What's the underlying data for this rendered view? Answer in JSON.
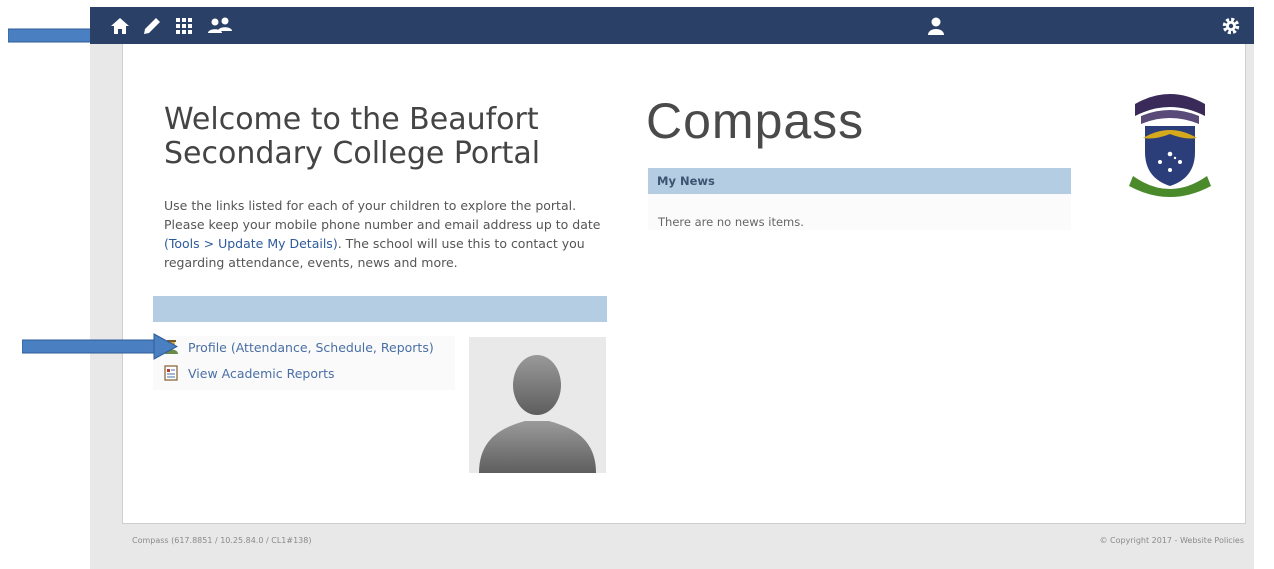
{
  "navbar": {
    "icons": [
      "home-icon",
      "pencil-icon",
      "grid-icon",
      "people-icon",
      "user-icon",
      "gear-icon"
    ]
  },
  "welcome": {
    "title": "Welcome to the Beaufort Secondary College Portal",
    "intro_1": "Use the links listed for each of your children to explore the portal. Please keep your mobile phone number and email address up to date ",
    "intro_link": "(Tools > Update My Details)",
    "intro_2": ". The school will use this to contact you regarding attendance, events, news and more."
  },
  "student": {
    "profile_link": "Profile (Attendance, Schedule, Reports)",
    "reports_link": "View Academic Reports"
  },
  "app_title": "Compass",
  "news": {
    "header": "My News",
    "empty_text": "There are no news items."
  },
  "footer": {
    "left": "Compass (617.8851 / 10.25.84.0 / CL1#138)",
    "right": "© Copyright 2017 - Website Policies"
  },
  "colors": {
    "navbar": "#2a4067",
    "section_header": "#b5cde2",
    "arrow": "#4a7fc1"
  }
}
